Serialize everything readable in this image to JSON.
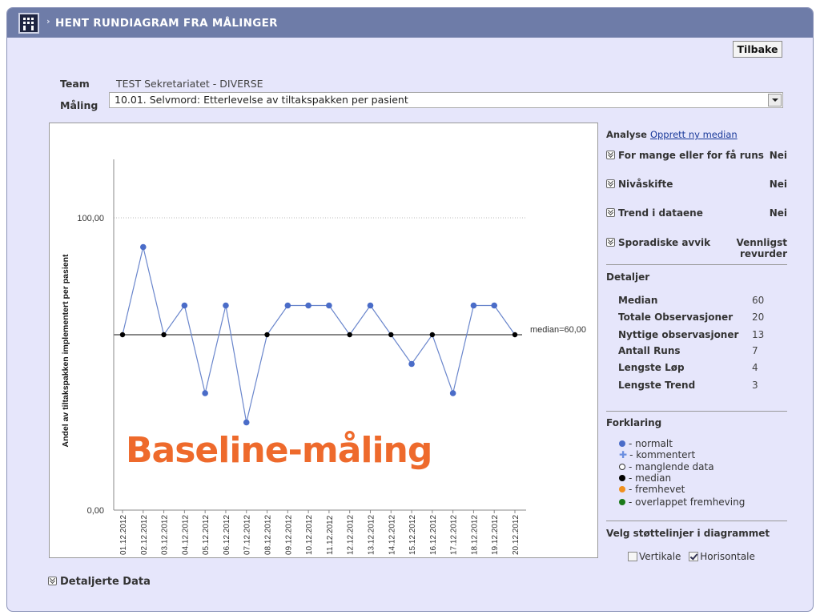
{
  "header": {
    "title": "HENT RUNDIAGRAM FRA MÅLINGER",
    "icon": "building-icon"
  },
  "toolbar": {
    "back_label": "Tilbake"
  },
  "form": {
    "team_label": "Team",
    "team_value": "TEST Sekretariatet - DIVERSE",
    "measure_label": "Måling",
    "measure_value": "10.01. Selvmord: Etterlevelse av tiltakspakken per pasient"
  },
  "overlay_text": "Baseline-måling",
  "analysis": {
    "label": "Analyse",
    "link": "Opprett ny median",
    "items": [
      {
        "label": "For mange eller for få runs",
        "value": "Nei"
      },
      {
        "label": "Nivåskifte",
        "value": "Nei"
      },
      {
        "label": "Trend i dataene",
        "value": "Nei"
      },
      {
        "label": "Sporadiske avvik",
        "value": "Vennligst revurder"
      }
    ]
  },
  "details": {
    "title": "Detaljer",
    "rows": [
      {
        "label": "Median",
        "value": "60"
      },
      {
        "label": "Totale Observasjoner",
        "value": "20"
      },
      {
        "label": "Nyttige observasjoner",
        "value": "13"
      },
      {
        "label": "Antall Runs",
        "value": "7"
      },
      {
        "label": "Lengste Løp",
        "value": "4"
      },
      {
        "label": "Lengste Trend",
        "value": "3"
      }
    ]
  },
  "legend": {
    "title": "Forklaring",
    "items": [
      {
        "label": "- normalt",
        "color": "#4a6cc8",
        "shape": "dot"
      },
      {
        "label": "- kommentert",
        "color": "#6a8ee0",
        "shape": "plus"
      },
      {
        "label": "- manglende data",
        "color": "#ffffff",
        "shape": "ring"
      },
      {
        "label": "- median",
        "color": "#000000",
        "shape": "dot"
      },
      {
        "label": "- fremhevet",
        "color": "#f0901e",
        "shape": "dot"
      },
      {
        "label": "- overlappet fremheving",
        "color": "#1a7a1a",
        "shape": "dot"
      }
    ]
  },
  "support_lines": {
    "title": "Velg støttelinjer i diagrammet",
    "vertical_label": "Vertikale",
    "vertical_checked": false,
    "horizontal_label": "Horisontale",
    "horizontal_checked": true
  },
  "footer": {
    "detailed_data": "Detaljerte Data"
  },
  "chart_data": {
    "type": "line",
    "title": "",
    "xlabel": "",
    "ylabel": "Andel av tiltakspakken implementert per pasient",
    "ylim": [
      0,
      100
    ],
    "y_ticks": [
      "0,00",
      "100,00"
    ],
    "categories": [
      "01.12.2012",
      "02.12.2012",
      "03.12.2012",
      "04.12.2012",
      "05.12.2012",
      "06.12.2012",
      "07.12.2012",
      "08.12.2012",
      "09.12.2012",
      "10.12.2012",
      "11.12.2012",
      "12.12.2012",
      "13.12.2012",
      "14.12.2012",
      "15.12.2012",
      "16.12.2012",
      "17.12.2012",
      "18.12.2012",
      "19.12.2012",
      "20.12.2012"
    ],
    "series": [
      {
        "name": "Måling",
        "values": [
          60,
          90,
          60,
          70,
          40,
          70,
          30,
          60,
          70,
          70,
          70,
          60,
          70,
          60,
          50,
          60,
          40,
          70,
          70,
          60
        ],
        "color": "#6a86cc"
      }
    ],
    "median": 60,
    "median_label": "median=60,00",
    "grid": "horizontal",
    "point_color": "#4a6cc8",
    "median_point_color": "#000000"
  }
}
